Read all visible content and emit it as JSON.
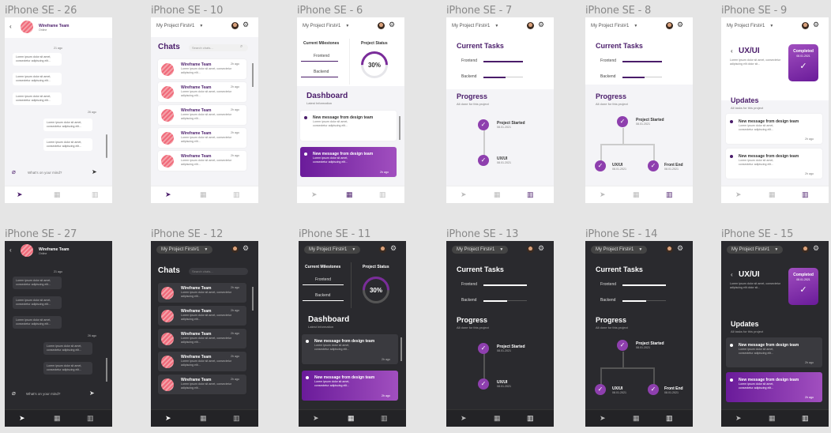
{
  "frames": [
    {
      "id": "se26",
      "label": "iPhone SE - 26"
    },
    {
      "id": "se10",
      "label": "iPhone SE - 10"
    },
    {
      "id": "se6",
      "label": "iPhone SE - 6"
    },
    {
      "id": "se7",
      "label": "iPhone SE - 7"
    },
    {
      "id": "se8",
      "label": "iPhone SE - 8"
    },
    {
      "id": "se9",
      "label": "iPhone SE - 9"
    },
    {
      "id": "se27",
      "label": "iPhone SE - 27"
    },
    {
      "id": "se12",
      "label": "iPhone SE - 12"
    },
    {
      "id": "se11",
      "label": "iPhone SE - 11"
    },
    {
      "id": "se13",
      "label": "iPhone SE - 13"
    },
    {
      "id": "se14",
      "label": "iPhone SE - 14"
    },
    {
      "id": "se15",
      "label": "iPhone SE - 15"
    }
  ],
  "project_select": "My Project First#1",
  "chat": {
    "team": "Wireframe Team",
    "status": "Online",
    "day1": "21 ago",
    "day2": "26 ago",
    "msg": "Lorem ipsum dolor sit amet, consectetur adipiscing elit...",
    "placeholder": "What's on your mind?"
  },
  "chats": {
    "title": "Chats",
    "search": "Search chats...",
    "items": [
      {
        "name": "Wireframe Team",
        "time": "2h ago",
        "text": "Lorem ipsum dolor sit amet, consectetur adipiscing elit..."
      },
      {
        "name": "Wireframe Team",
        "time": "2h ago",
        "text": "Lorem ipsum dolor sit amet, consectetur adipiscing elit..."
      },
      {
        "name": "Wireframe Team",
        "time": "2h ago",
        "text": "Lorem ipsum dolor sit amet, consectetur adipiscing elit..."
      },
      {
        "name": "Wireframe Team",
        "time": "2h ago",
        "text": "Lorem ipsum dolor sit amet, consectetur adipiscing elit..."
      },
      {
        "name": "Wireframe Team",
        "time": "2h ago",
        "text": "Lorem ipsum dolor sit amet, consectetur adipiscing elit..."
      }
    ]
  },
  "dashboard": {
    "milestones": "Current Milestones",
    "status": "Project Status",
    "m1": "Frontend",
    "m2": "Backend",
    "percent_label": "30%",
    "percent_value": 30,
    "title": "Dashboard",
    "sub": "Latest Information",
    "n1": "New message from design team",
    "n_text": "Lorem ipsum dolor sit amet, consectetur adipiscing elit...",
    "n2": "New message from design team",
    "time": "2h ago"
  },
  "tasks": {
    "title": "Current Tasks",
    "t1": "Frontend",
    "t2": "Backend",
    "progress": "Progress",
    "progress_sub": "All done for this project",
    "s1": "Project Started",
    "s2": "UX/UI",
    "s3": "Front End",
    "date": "08.01.2021"
  },
  "updates": {
    "title": "UX/UI",
    "desc": "Lorem ipsum dolor sit amet, consectetur adipiscing elit dolor sit...",
    "completed": "Completed",
    "date": "08.01.2021",
    "updates": "Updates",
    "updates_sub": "All tasks for this project",
    "u1": "New message from design team",
    "u_text": "Lorem ipsum dolor sit amet, consectetur adipiscing elit...",
    "time": "2h ago"
  }
}
